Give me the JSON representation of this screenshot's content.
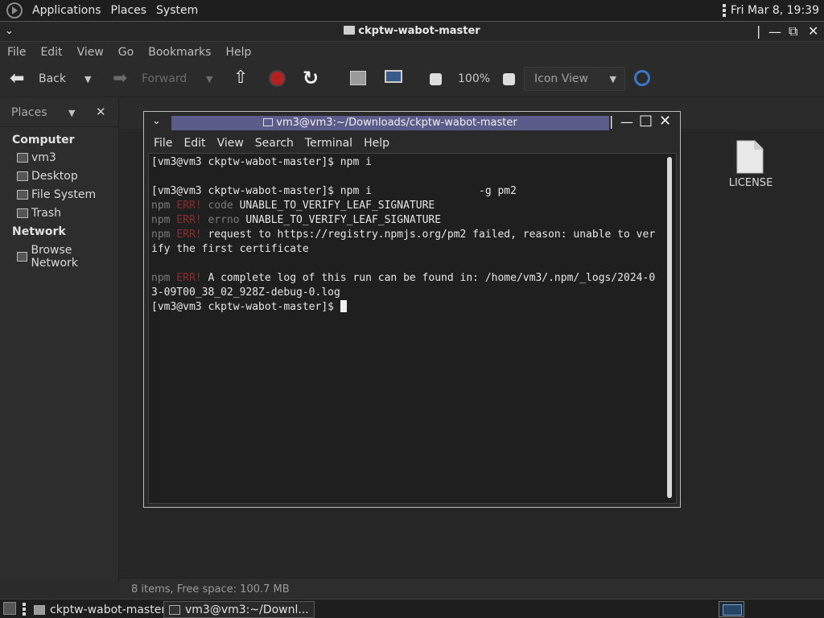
{
  "top_panel": {
    "menus": [
      "Applications",
      "Places",
      "System"
    ],
    "clock": "Fri Mar  8, 19:39"
  },
  "file_manager": {
    "title": "ckptw-wabot-master",
    "menu": [
      "File",
      "Edit",
      "View",
      "Go",
      "Bookmarks",
      "Help"
    ],
    "toolbar": {
      "back": "Back",
      "forward": "Forward",
      "zoom": "100%",
      "view_mode": "Icon View"
    },
    "sidebar": {
      "header": "Places",
      "sections": [
        {
          "title": "Computer",
          "items": [
            "vm3",
            "Desktop",
            "File System",
            "Trash"
          ]
        },
        {
          "title": "Network",
          "items": [
            "Browse Network"
          ]
        }
      ]
    },
    "files": [
      {
        "name": "LICENSE"
      }
    ],
    "status": "8 items, Free space: 100.7 MB"
  },
  "terminal": {
    "title": "vm3@vm3:~/Downloads/ckptw-wabot-master",
    "menu": [
      "File",
      "Edit",
      "View",
      "Search",
      "Terminal",
      "Help"
    ],
    "lines": {
      "l1": "[vm3@vm3 ckptw-wabot-master]$ npm i",
      "l2": "[vm3@vm3 ckptw-wabot-master]$ npm i                 -g pm2",
      "l3_pre": "npm ",
      "l3_err": "ERR!",
      "l3_key": " code",
      "l3_val": " UNABLE_TO_VERIFY_LEAF_SIGNATURE",
      "l4_pre": "npm ",
      "l4_err": "ERR!",
      "l4_key": " errno",
      "l4_val": " UNABLE_TO_VERIFY_LEAF_SIGNATURE",
      "l5_pre": "npm ",
      "l5_err": "ERR!",
      "l5_val": " request to https://registry.npmjs.org/pm2 failed, reason: unable to ver",
      "l6": "ify the first certificate",
      "l7_pre": "npm ",
      "l7_err": "ERR!",
      "l7_val": " A complete log of this run can be found in: /home/vm3/.npm/_logs/2024-0",
      "l8": "3-09T00_38_02_928Z-debug-0.log",
      "l9": "[vm3@vm3 ckptw-wabot-master]$ "
    }
  },
  "taskbar": {
    "tasks": [
      "ckptw-wabot-master",
      "vm3@vm3:~/Downl..."
    ]
  }
}
